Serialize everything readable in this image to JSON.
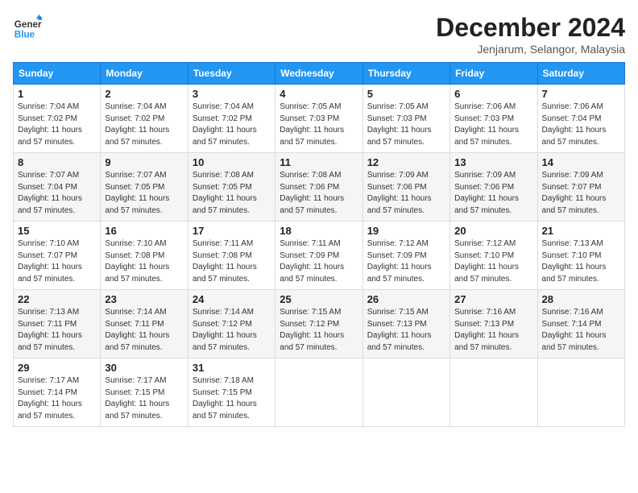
{
  "header": {
    "logo_line1": "General",
    "logo_line2": "Blue",
    "month_title": "December 2024",
    "subtitle": "Jenjarum, Selangor, Malaysia"
  },
  "weekdays": [
    "Sunday",
    "Monday",
    "Tuesday",
    "Wednesday",
    "Thursday",
    "Friday",
    "Saturday"
  ],
  "weeks": [
    [
      {
        "day": "1",
        "sunrise": "7:04 AM",
        "sunset": "7:02 PM",
        "daylight": "11 hours and 57 minutes."
      },
      {
        "day": "2",
        "sunrise": "7:04 AM",
        "sunset": "7:02 PM",
        "daylight": "11 hours and 57 minutes."
      },
      {
        "day": "3",
        "sunrise": "7:04 AM",
        "sunset": "7:02 PM",
        "daylight": "11 hours and 57 minutes."
      },
      {
        "day": "4",
        "sunrise": "7:05 AM",
        "sunset": "7:03 PM",
        "daylight": "11 hours and 57 minutes."
      },
      {
        "day": "5",
        "sunrise": "7:05 AM",
        "sunset": "7:03 PM",
        "daylight": "11 hours and 57 minutes."
      },
      {
        "day": "6",
        "sunrise": "7:06 AM",
        "sunset": "7:03 PM",
        "daylight": "11 hours and 57 minutes."
      },
      {
        "day": "7",
        "sunrise": "7:06 AM",
        "sunset": "7:04 PM",
        "daylight": "11 hours and 57 minutes."
      }
    ],
    [
      {
        "day": "8",
        "sunrise": "7:07 AM",
        "sunset": "7:04 PM",
        "daylight": "11 hours and 57 minutes."
      },
      {
        "day": "9",
        "sunrise": "7:07 AM",
        "sunset": "7:05 PM",
        "daylight": "11 hours and 57 minutes."
      },
      {
        "day": "10",
        "sunrise": "7:08 AM",
        "sunset": "7:05 PM",
        "daylight": "11 hours and 57 minutes."
      },
      {
        "day": "11",
        "sunrise": "7:08 AM",
        "sunset": "7:06 PM",
        "daylight": "11 hours and 57 minutes."
      },
      {
        "day": "12",
        "sunrise": "7:09 AM",
        "sunset": "7:06 PM",
        "daylight": "11 hours and 57 minutes."
      },
      {
        "day": "13",
        "sunrise": "7:09 AM",
        "sunset": "7:06 PM",
        "daylight": "11 hours and 57 minutes."
      },
      {
        "day": "14",
        "sunrise": "7:09 AM",
        "sunset": "7:07 PM",
        "daylight": "11 hours and 57 minutes."
      }
    ],
    [
      {
        "day": "15",
        "sunrise": "7:10 AM",
        "sunset": "7:07 PM",
        "daylight": "11 hours and 57 minutes."
      },
      {
        "day": "16",
        "sunrise": "7:10 AM",
        "sunset": "7:08 PM",
        "daylight": "11 hours and 57 minutes."
      },
      {
        "day": "17",
        "sunrise": "7:11 AM",
        "sunset": "7:08 PM",
        "daylight": "11 hours and 57 minutes."
      },
      {
        "day": "18",
        "sunrise": "7:11 AM",
        "sunset": "7:09 PM",
        "daylight": "11 hours and 57 minutes."
      },
      {
        "day": "19",
        "sunrise": "7:12 AM",
        "sunset": "7:09 PM",
        "daylight": "11 hours and 57 minutes."
      },
      {
        "day": "20",
        "sunrise": "7:12 AM",
        "sunset": "7:10 PM",
        "daylight": "11 hours and 57 minutes."
      },
      {
        "day": "21",
        "sunrise": "7:13 AM",
        "sunset": "7:10 PM",
        "daylight": "11 hours and 57 minutes."
      }
    ],
    [
      {
        "day": "22",
        "sunrise": "7:13 AM",
        "sunset": "7:11 PM",
        "daylight": "11 hours and 57 minutes."
      },
      {
        "day": "23",
        "sunrise": "7:14 AM",
        "sunset": "7:11 PM",
        "daylight": "11 hours and 57 minutes."
      },
      {
        "day": "24",
        "sunrise": "7:14 AM",
        "sunset": "7:12 PM",
        "daylight": "11 hours and 57 minutes."
      },
      {
        "day": "25",
        "sunrise": "7:15 AM",
        "sunset": "7:12 PM",
        "daylight": "11 hours and 57 minutes."
      },
      {
        "day": "26",
        "sunrise": "7:15 AM",
        "sunset": "7:13 PM",
        "daylight": "11 hours and 57 minutes."
      },
      {
        "day": "27",
        "sunrise": "7:16 AM",
        "sunset": "7:13 PM",
        "daylight": "11 hours and 57 minutes."
      },
      {
        "day": "28",
        "sunrise": "7:16 AM",
        "sunset": "7:14 PM",
        "daylight": "11 hours and 57 minutes."
      }
    ],
    [
      {
        "day": "29",
        "sunrise": "7:17 AM",
        "sunset": "7:14 PM",
        "daylight": "11 hours and 57 minutes."
      },
      {
        "day": "30",
        "sunrise": "7:17 AM",
        "sunset": "7:15 PM",
        "daylight": "11 hours and 57 minutes."
      },
      {
        "day": "31",
        "sunrise": "7:18 AM",
        "sunset": "7:15 PM",
        "daylight": "11 hours and 57 minutes."
      },
      null,
      null,
      null,
      null
    ]
  ]
}
